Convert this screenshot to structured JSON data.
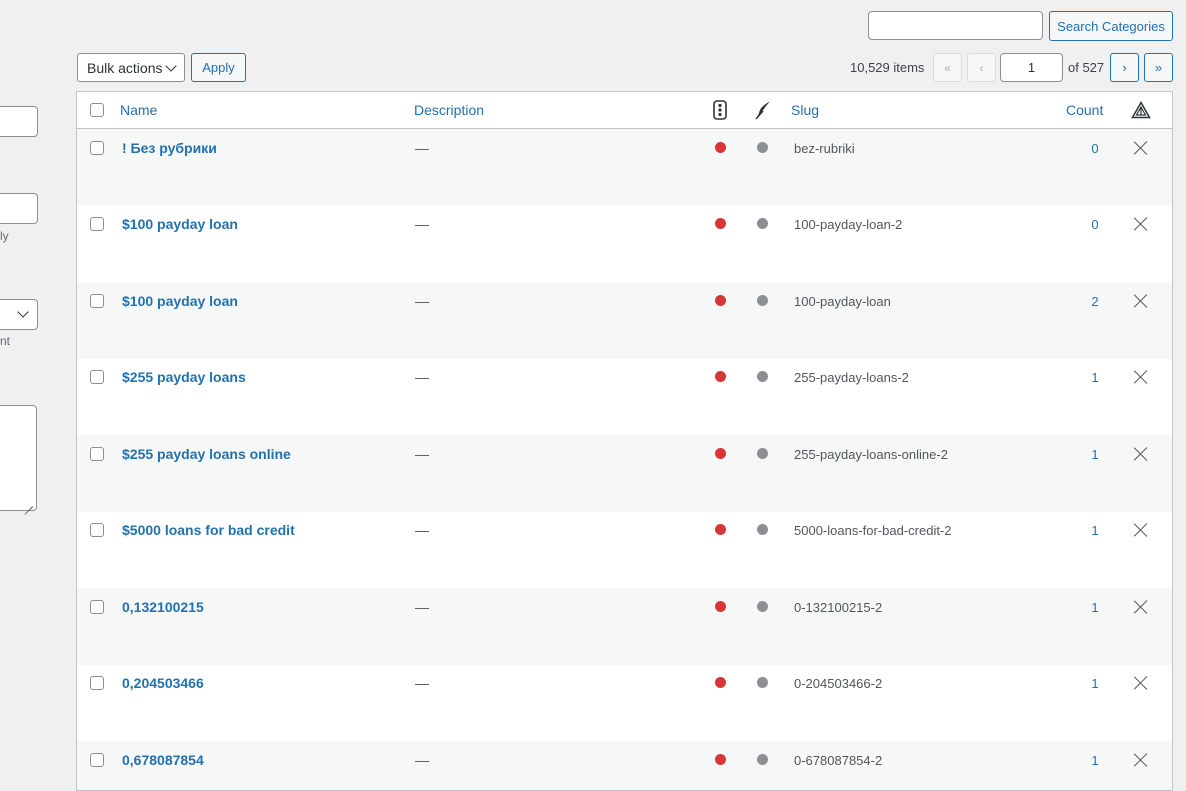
{
  "left_form": {
    "note_1": "ly",
    "note_2": "nt"
  },
  "search": {
    "value": "",
    "button_label": "Search Categories"
  },
  "bulk_actions": {
    "selected": "Bulk actions",
    "apply_label": "Apply"
  },
  "pagination": {
    "items_count": "10,529 items",
    "first": "«",
    "prev": "‹",
    "current_page": "1",
    "of_total": "of 527",
    "next": "›",
    "last": "»"
  },
  "table": {
    "columns": {
      "name": "Name",
      "description": "Description",
      "slug": "Slug",
      "count": "Count"
    },
    "rows": [
      {
        "name": "! Без рубрики",
        "description": "—",
        "slug": "bez-rubriki",
        "count": "0"
      },
      {
        "name": "$100 payday loan",
        "description": "—",
        "slug": "100-payday-loan-2",
        "count": "0"
      },
      {
        "name": "$100 payday loan",
        "description": "—",
        "slug": "100-payday-loan",
        "count": "2"
      },
      {
        "name": "$255 payday loans",
        "description": "—",
        "slug": "255-payday-loans-2",
        "count": "1"
      },
      {
        "name": "$255 payday loans online",
        "description": "—",
        "slug": "255-payday-loans-online-2",
        "count": "1"
      },
      {
        "name": "$5000 loans for bad credit",
        "description": "—",
        "slug": "5000-loans-for-bad-credit-2",
        "count": "1"
      },
      {
        "name": "0,132100215",
        "description": "—",
        "slug": "0-132100215-2",
        "count": "1"
      },
      {
        "name": "0,204503466",
        "description": "—",
        "slug": "0-204503466-2",
        "count": "1"
      },
      {
        "name": "0,678087854",
        "description": "—",
        "slug": "0-678087854-2",
        "count": "1"
      }
    ]
  },
  "icons": {
    "column_status": "traffic-light-icon",
    "column_feather": "feather-icon",
    "column_seo": "warning-triangle-icon",
    "row_status": "red-dot-icon",
    "row_indicator": "gray-dot-icon",
    "row_delete": "close-icon"
  },
  "colors": {
    "link": "#2271b1",
    "status_red": "#d63638",
    "status_gray": "#8c8f94",
    "background": "#f0f0f1"
  }
}
